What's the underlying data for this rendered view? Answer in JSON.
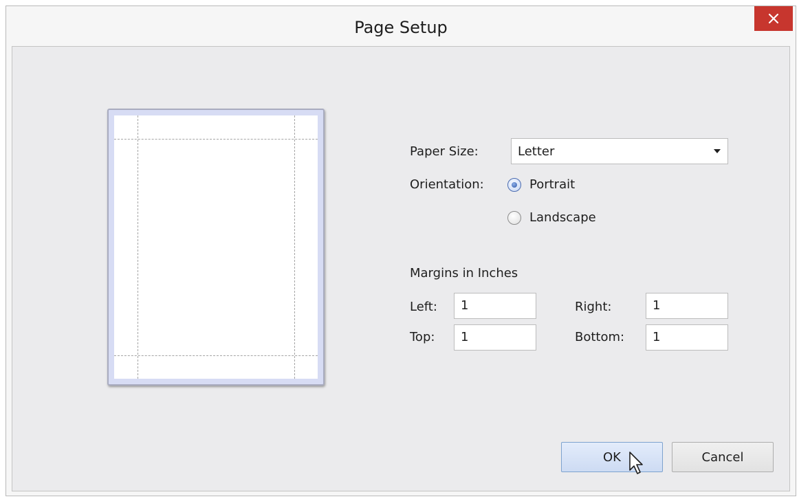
{
  "window": {
    "title": "Page Setup",
    "close_icon": "close-icon"
  },
  "preview": {
    "paper_color": "#ffffff",
    "frame_color": "#d7dcf4"
  },
  "paper_size": {
    "label": "Paper Size:",
    "value": "Letter",
    "arrow_icon": "chevron-down-icon"
  },
  "orientation": {
    "label": "Orientation:",
    "options": [
      {
        "label": "Portrait",
        "selected": true
      },
      {
        "label": "Landscape",
        "selected": false
      }
    ]
  },
  "margins": {
    "heading": "Margins in Inches",
    "left": {
      "label": "Left:",
      "value": "1"
    },
    "right": {
      "label": "Right:",
      "value": "1"
    },
    "top": {
      "label": "Top:",
      "value": "1"
    },
    "bottom": {
      "label": "Bottom:",
      "value": "1"
    }
  },
  "buttons": {
    "ok": "OK",
    "cancel": "Cancel"
  },
  "colors": {
    "close_button": "#c7362e",
    "ok_button_border": "#7da2ce",
    "radio_selected": "#2d57a8"
  }
}
